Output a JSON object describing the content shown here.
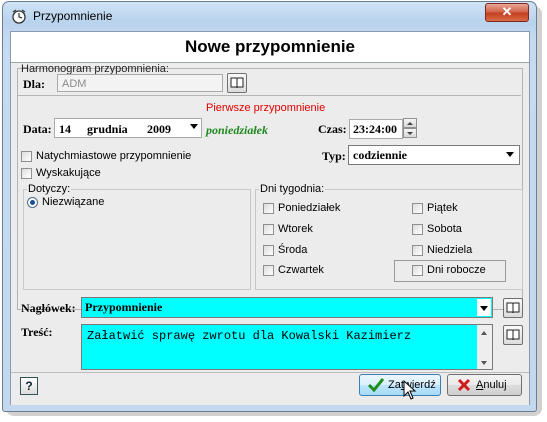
{
  "window": {
    "title": "Przypomnienie",
    "close_symbol": "✕"
  },
  "form": {
    "heading": "Nowe przypomnienie",
    "schedule_label": "Harmonogram przypomnienia:",
    "for_label": "Dla:",
    "for_value": "ADM",
    "first_reminder_label": "Pierwsze przypomnienie",
    "date_label": "Data:",
    "date_day": "14",
    "date_month": "grudnia",
    "date_year": "2009",
    "weekday": "poniedziałek",
    "time_label": "Czas:",
    "time_value": "23:24:00",
    "immediate_label": "Natychmiastowe przypomnienie",
    "popup_label": "Wyskakujące",
    "type_label": "Typ:",
    "type_value": "codziennie",
    "applies_group": "Dotyczy:",
    "applies_option": "Niezwiązane",
    "days_group": "Dni tygodnia:",
    "days": {
      "mon": "Poniedziałek",
      "tue": "Wtorek",
      "wed": "Środa",
      "thu": "Czwartek",
      "fri": "Piątek",
      "sat": "Sobota",
      "sun": "Niedziela",
      "workdays": "Dni robocze"
    },
    "subject_label": "Nagłówek:",
    "subject_value": "Przypomnienie",
    "content_label": "Treść:",
    "content_value": "Załatwić sprawę zwrotu dla Kowalski Kazimierz"
  },
  "buttons": {
    "help": "?",
    "confirm_pre": "Za",
    "confirm_u": "t",
    "confirm_post": "wierdź",
    "cancel_u": "A",
    "cancel_post": "nuluj"
  },
  "colors": {
    "field_highlight": "#00ffff",
    "first_reminder": "#e00000",
    "weekday": "#1f8a1f"
  }
}
